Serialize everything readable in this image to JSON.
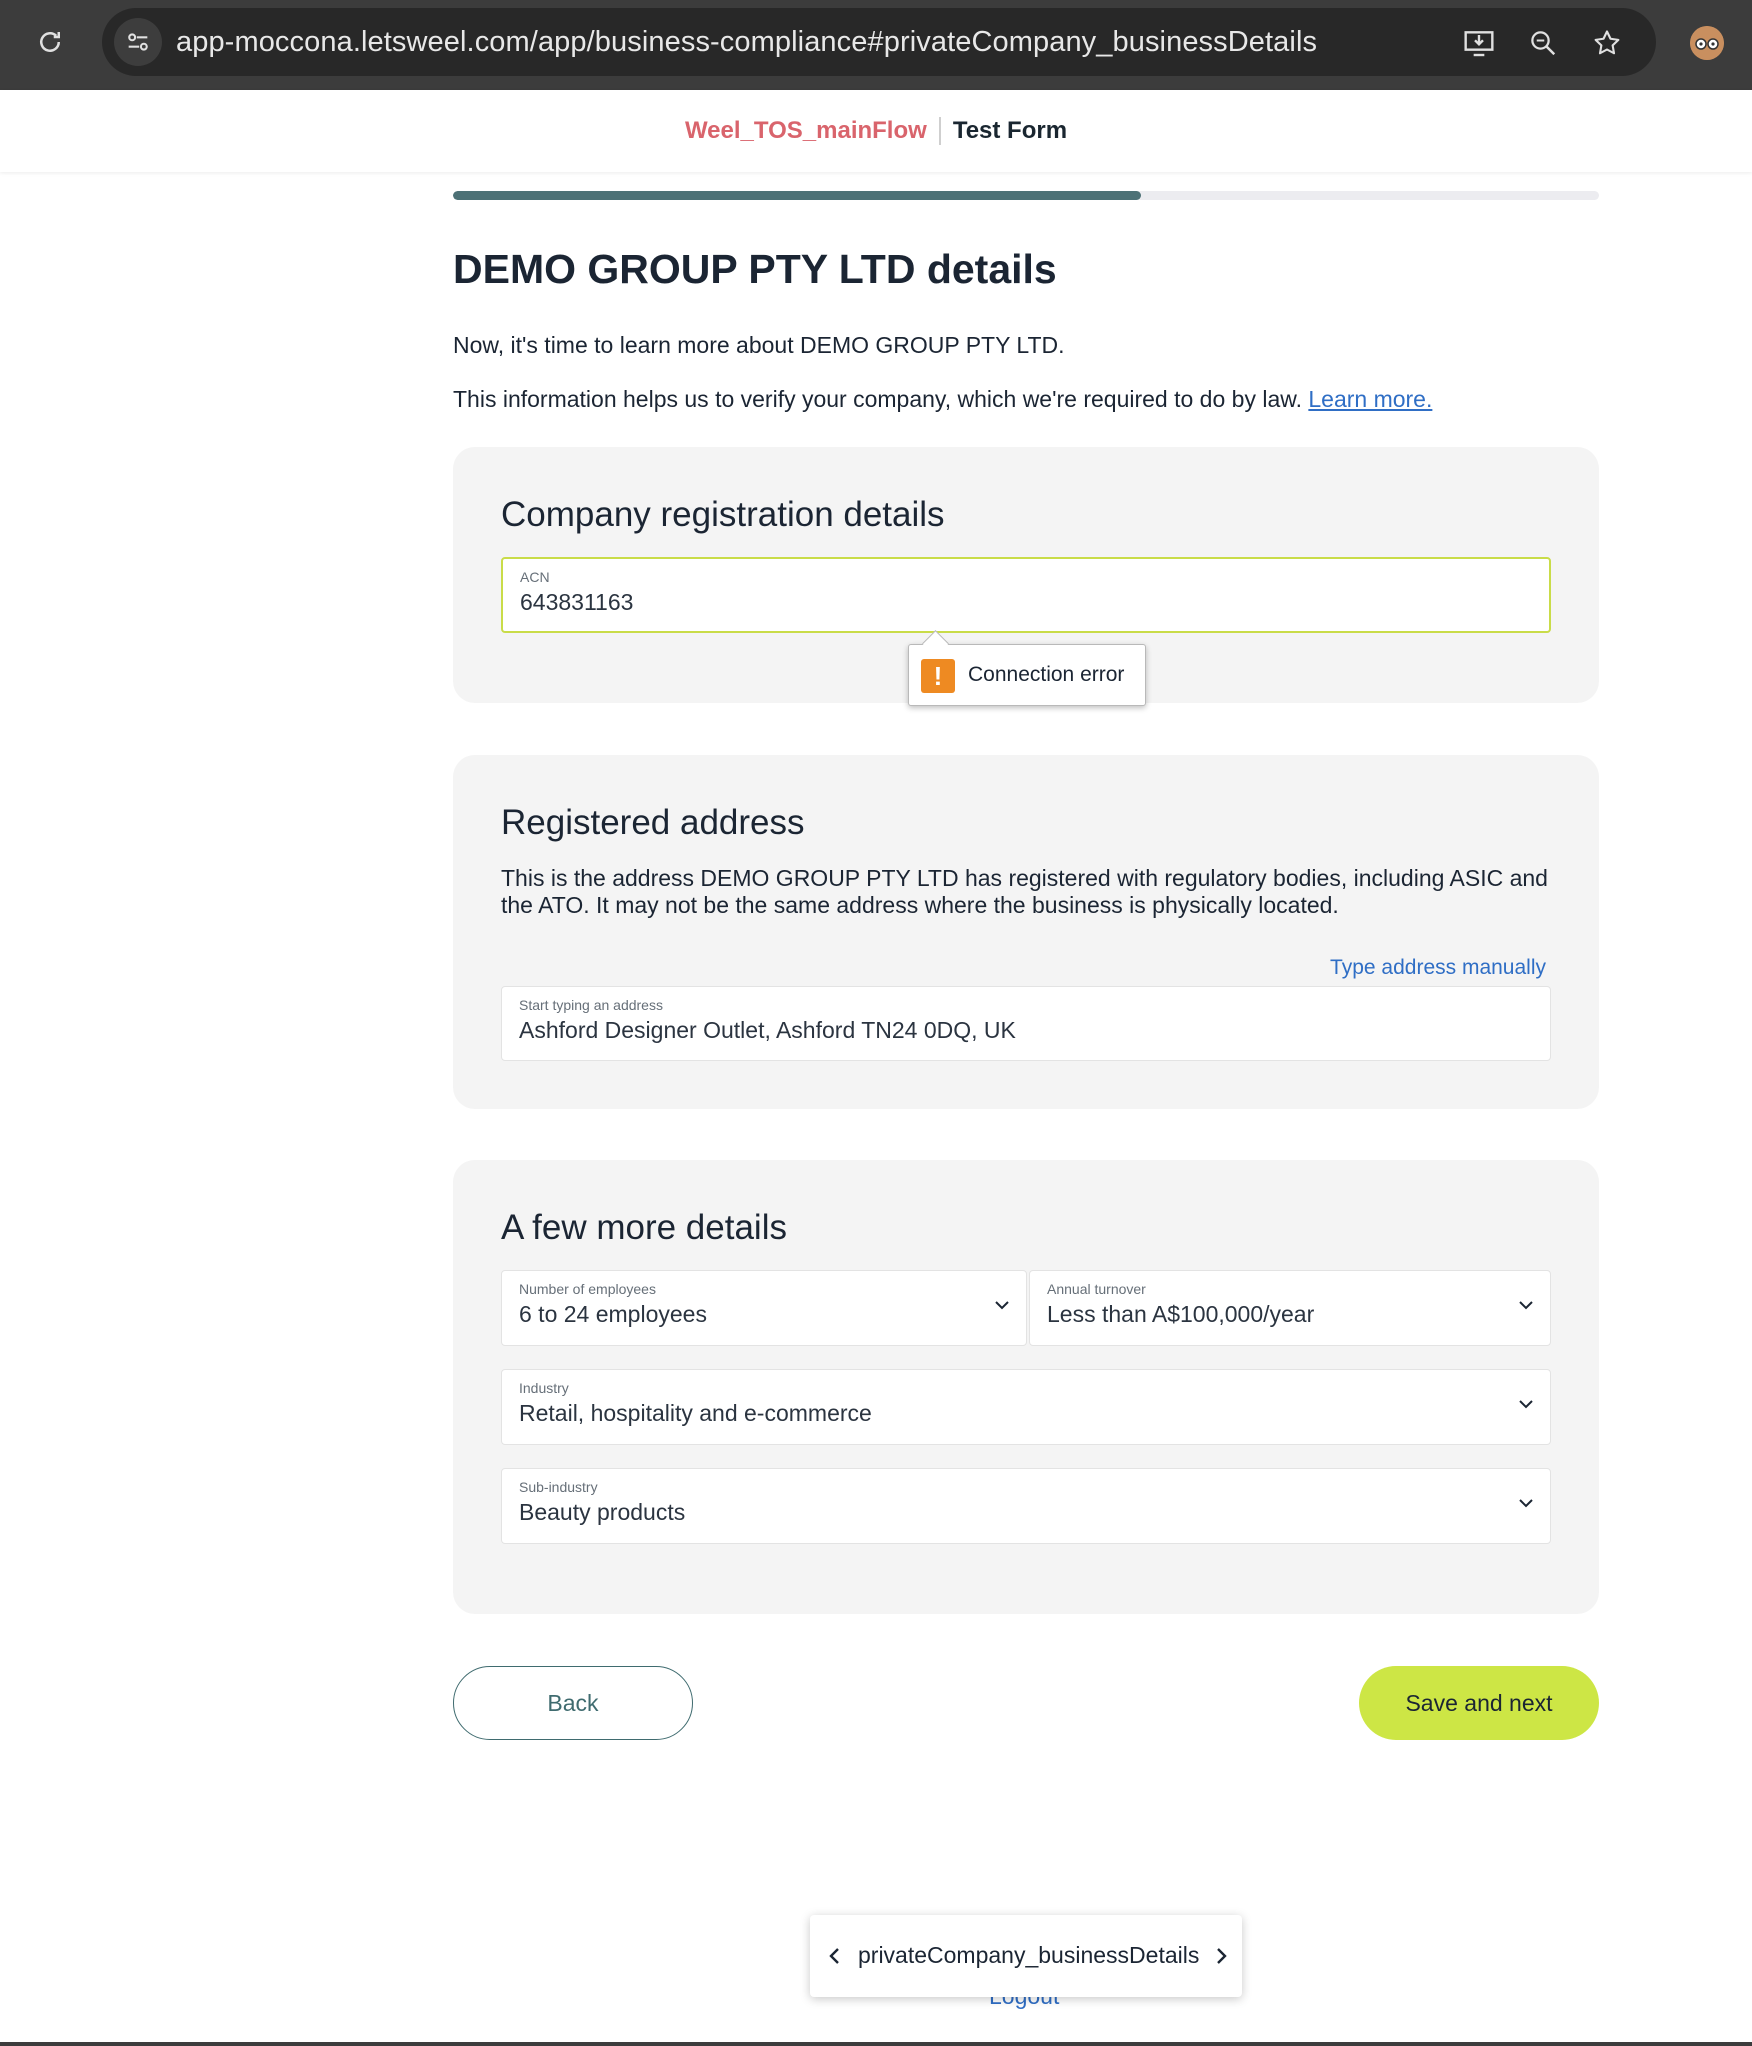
{
  "browser": {
    "url": "app-moccona.letsweel.com/app/business-compliance#privateCompany_businessDetails"
  },
  "header": {
    "flow_name": "Weel_TOS_mainFlow",
    "form_name": "Test Form"
  },
  "progress": {
    "fraction": 0.6
  },
  "page": {
    "title": "DEMO GROUP PTY LTD details",
    "intro": "Now, it's time to learn more about DEMO GROUP PTY LTD.",
    "info": "This information helps us to verify your company, which we're required to do by law.",
    "learn_more": "Learn more."
  },
  "registration": {
    "heading": "Company registration details",
    "acn_label": "ACN",
    "acn_value": "643831163",
    "error": "Connection error"
  },
  "address": {
    "heading": "Registered address",
    "description": "This is the address DEMO GROUP PTY LTD has registered with regulatory bodies, including ASIC and the ATO. It may not be the same address where the business is physically located.",
    "manual_link": "Type address manually",
    "field_label": "Start typing an address",
    "field_value": "Ashford Designer Outlet, Ashford TN24 0DQ, UK"
  },
  "details": {
    "heading": "A few more details",
    "employees_label": "Number of employees",
    "employees_value": "6 to 24 employees",
    "turnover_label": "Annual turnover",
    "turnover_value": "Less than A$100,000/year",
    "industry_label": "Industry",
    "industry_value": "Retail, hospitality and e-commerce",
    "subindustry_label": "Sub-industry",
    "subindustry_value": "Beauty products"
  },
  "actions": {
    "back": "Back",
    "save": "Save and next"
  },
  "footer": {
    "logout": "Logout",
    "step_name": "privateCompany_businessDetails"
  }
}
